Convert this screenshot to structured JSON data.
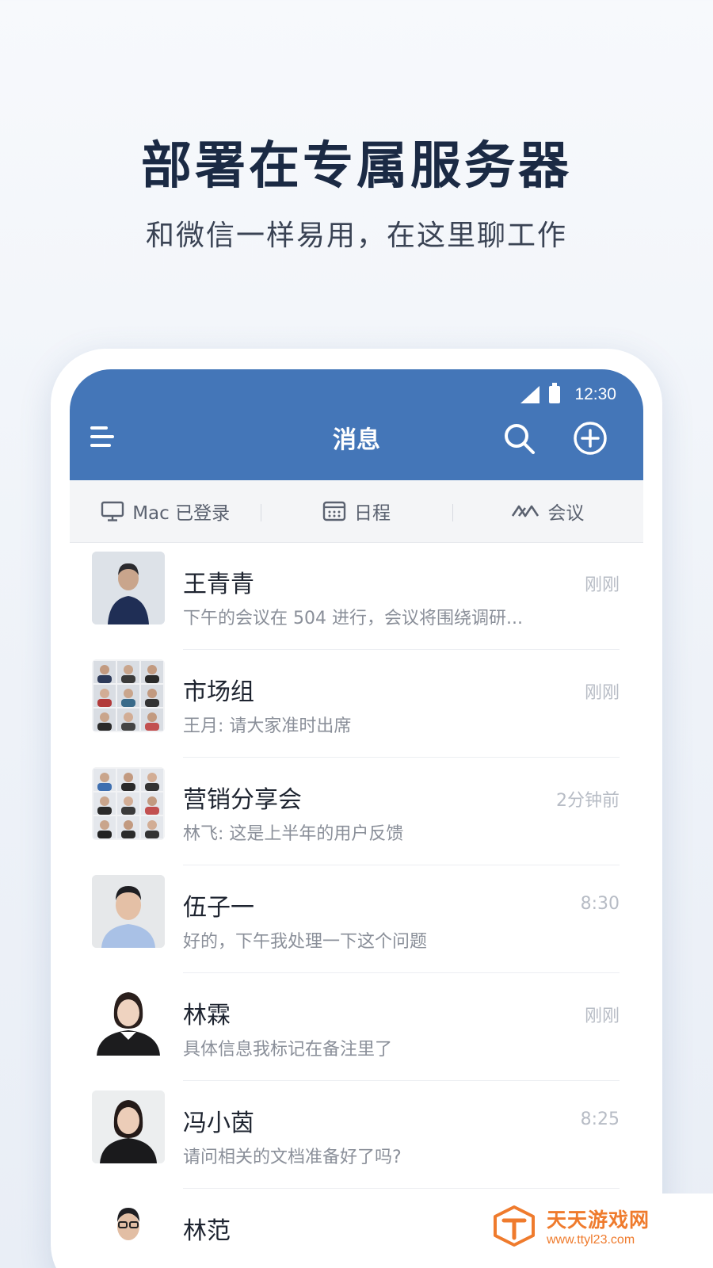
{
  "promo": {
    "headline": "部署在专属服务器",
    "subline": "和微信一样易用，在这里聊工作"
  },
  "status_bar": {
    "time": "12:30",
    "icons": [
      "signal-icon",
      "battery-icon"
    ]
  },
  "app_bar": {
    "title": "消息",
    "color": "#4476b8",
    "icons": [
      "menu-icon",
      "search-icon",
      "add-circle-icon"
    ]
  },
  "quick_bar": {
    "items": [
      {
        "label": "Mac 已登录",
        "icon": "desktop-icon"
      },
      {
        "label": "日程",
        "icon": "calendar-icon"
      },
      {
        "label": "会议",
        "icon": "meeting-icon"
      }
    ]
  },
  "conversations": [
    {
      "name": "王青青",
      "preview": "下午的会议在 504 进行，会议将围绕调研...",
      "time": "刚刚",
      "avatar": "single"
    },
    {
      "name": "市场组",
      "preview": "王月: 请大家准时出席",
      "time": "刚刚",
      "avatar": "group"
    },
    {
      "name": "营销分享会",
      "preview": "林飞: 这是上半年的用户反馈",
      "time": "2分钟前",
      "avatar": "group"
    },
    {
      "name": "伍子一",
      "preview": "好的，下午我处理一下这个问题",
      "time": "8:30",
      "avatar": "single"
    },
    {
      "name": "林霖",
      "preview": "具体信息我标记在备注里了",
      "time": "刚刚",
      "avatar": "single"
    },
    {
      "name": "冯小茵",
      "preview": "请问相关的文档准备好了吗?",
      "time": "8:25",
      "avatar": "single"
    },
    {
      "name": "林范",
      "preview": "",
      "time": "",
      "avatar": "single"
    }
  ],
  "watermark": {
    "title": "天天游戏网",
    "url": "www.ttyl23.com",
    "color": "#ef7b2d"
  }
}
